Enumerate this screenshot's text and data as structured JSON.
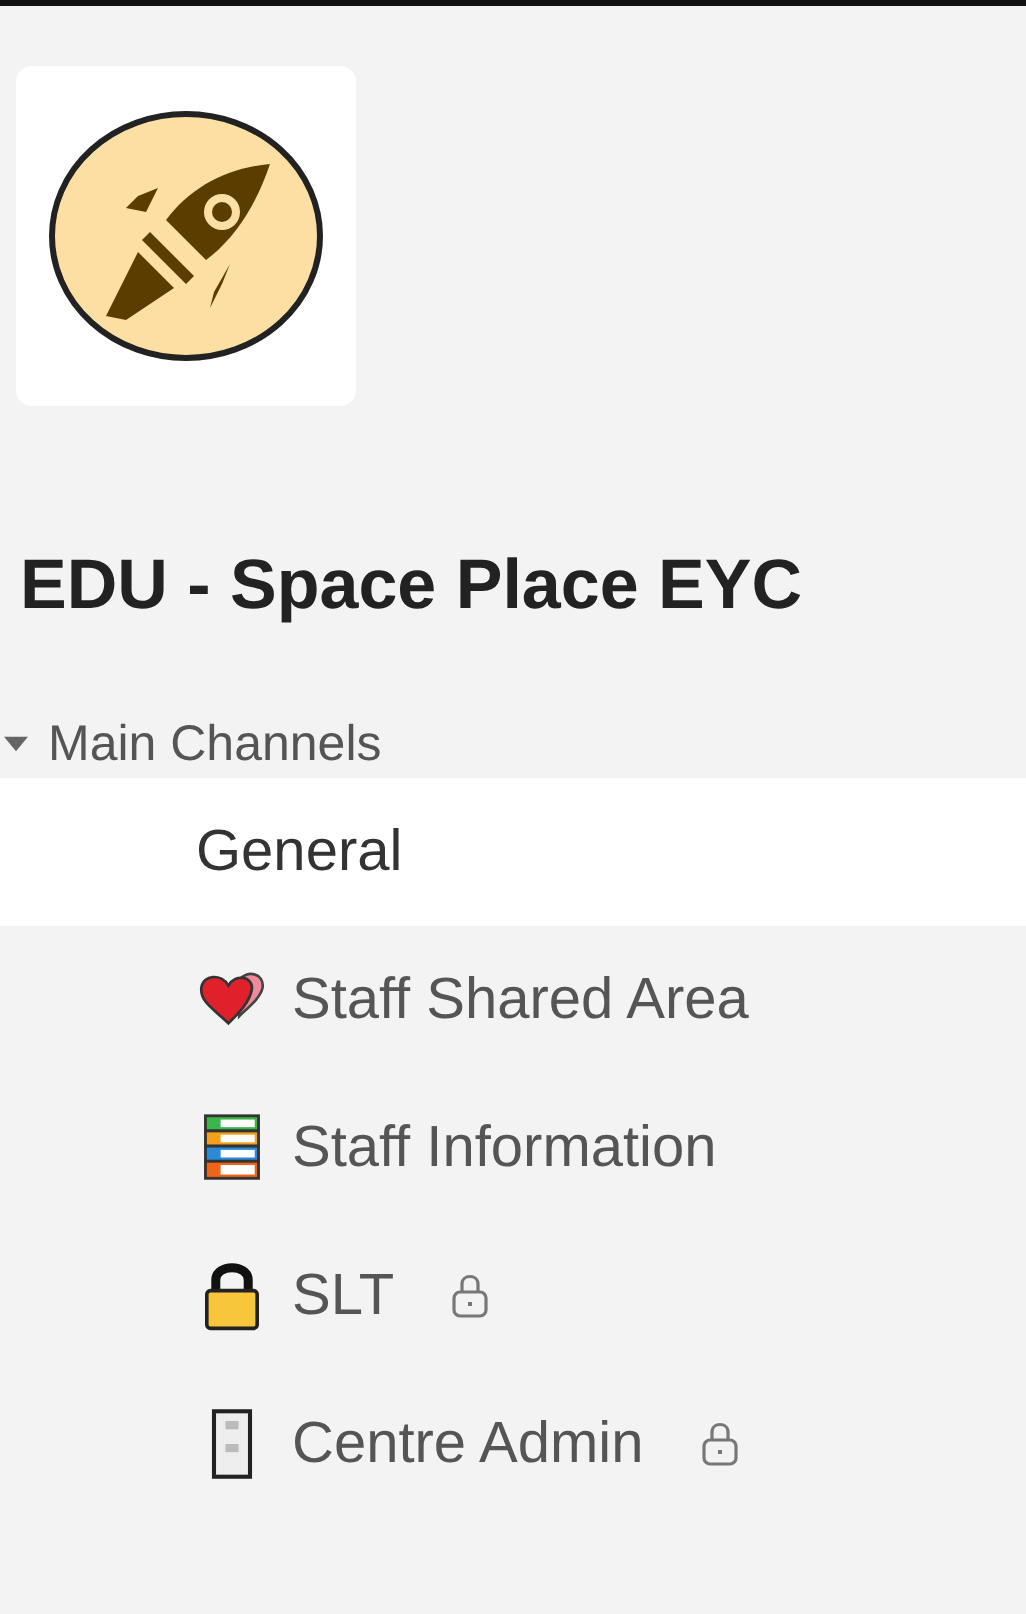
{
  "team": {
    "name": "EDU - Space Place EYC"
  },
  "section": {
    "label": "Main Channels",
    "expanded": true
  },
  "channels": [
    {
      "name": "General",
      "selected": true,
      "kind": "plain",
      "private": false
    },
    {
      "name": "Staff Shared Area",
      "selected": false,
      "kind": "hearts",
      "private": false
    },
    {
      "name": "Staff Information",
      "selected": false,
      "kind": "books",
      "private": false
    },
    {
      "name": "SLT",
      "selected": false,
      "kind": "padlock",
      "private": true
    },
    {
      "name": "Centre Admin",
      "selected": false,
      "kind": "cabinet",
      "private": true
    }
  ]
}
